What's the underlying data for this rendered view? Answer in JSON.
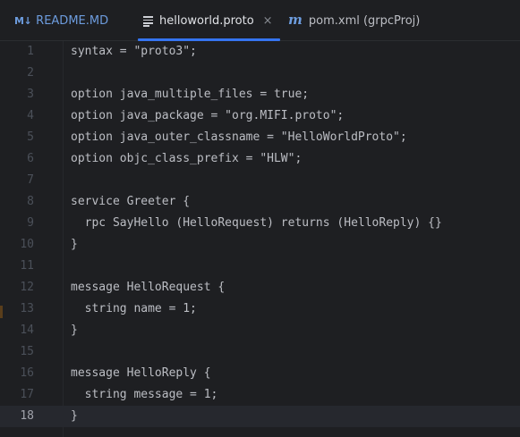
{
  "tabs": [
    {
      "icon": "markdown-icon",
      "icon_text": "M↓",
      "label": "README.MD"
    },
    {
      "icon": "proto-file-icon",
      "label": "helloworld.proto",
      "close": "×"
    },
    {
      "icon": "maven-icon",
      "icon_text": "m",
      "label": "pom.xml (grpcProj)"
    }
  ],
  "editor": {
    "current_line": 18,
    "lines": [
      {
        "n": "1",
        "text": "syntax = \"proto3\";"
      },
      {
        "n": "2",
        "text": ""
      },
      {
        "n": "3",
        "text": "option java_multiple_files = true;"
      },
      {
        "n": "4",
        "text": "option java_package = \"org.MIFI.proto\";"
      },
      {
        "n": "5",
        "text": "option java_outer_classname = \"HelloWorldProto\";"
      },
      {
        "n": "6",
        "text": "option objc_class_prefix = \"HLW\";"
      },
      {
        "n": "7",
        "text": ""
      },
      {
        "n": "8",
        "text": "service Greeter {"
      },
      {
        "n": "9",
        "text": "  rpc SayHello (HelloRequest) returns (HelloReply) {}"
      },
      {
        "n": "10",
        "text": "}"
      },
      {
        "n": "11",
        "text": ""
      },
      {
        "n": "12",
        "text": "message HelloRequest {"
      },
      {
        "n": "13",
        "text": "  string name = 1;"
      },
      {
        "n": "14",
        "text": "}"
      },
      {
        "n": "15",
        "text": ""
      },
      {
        "n": "16",
        "text": "message HelloReply {"
      },
      {
        "n": "17",
        "text": "  string message = 1;"
      },
      {
        "n": "18",
        "text": "}"
      }
    ]
  }
}
